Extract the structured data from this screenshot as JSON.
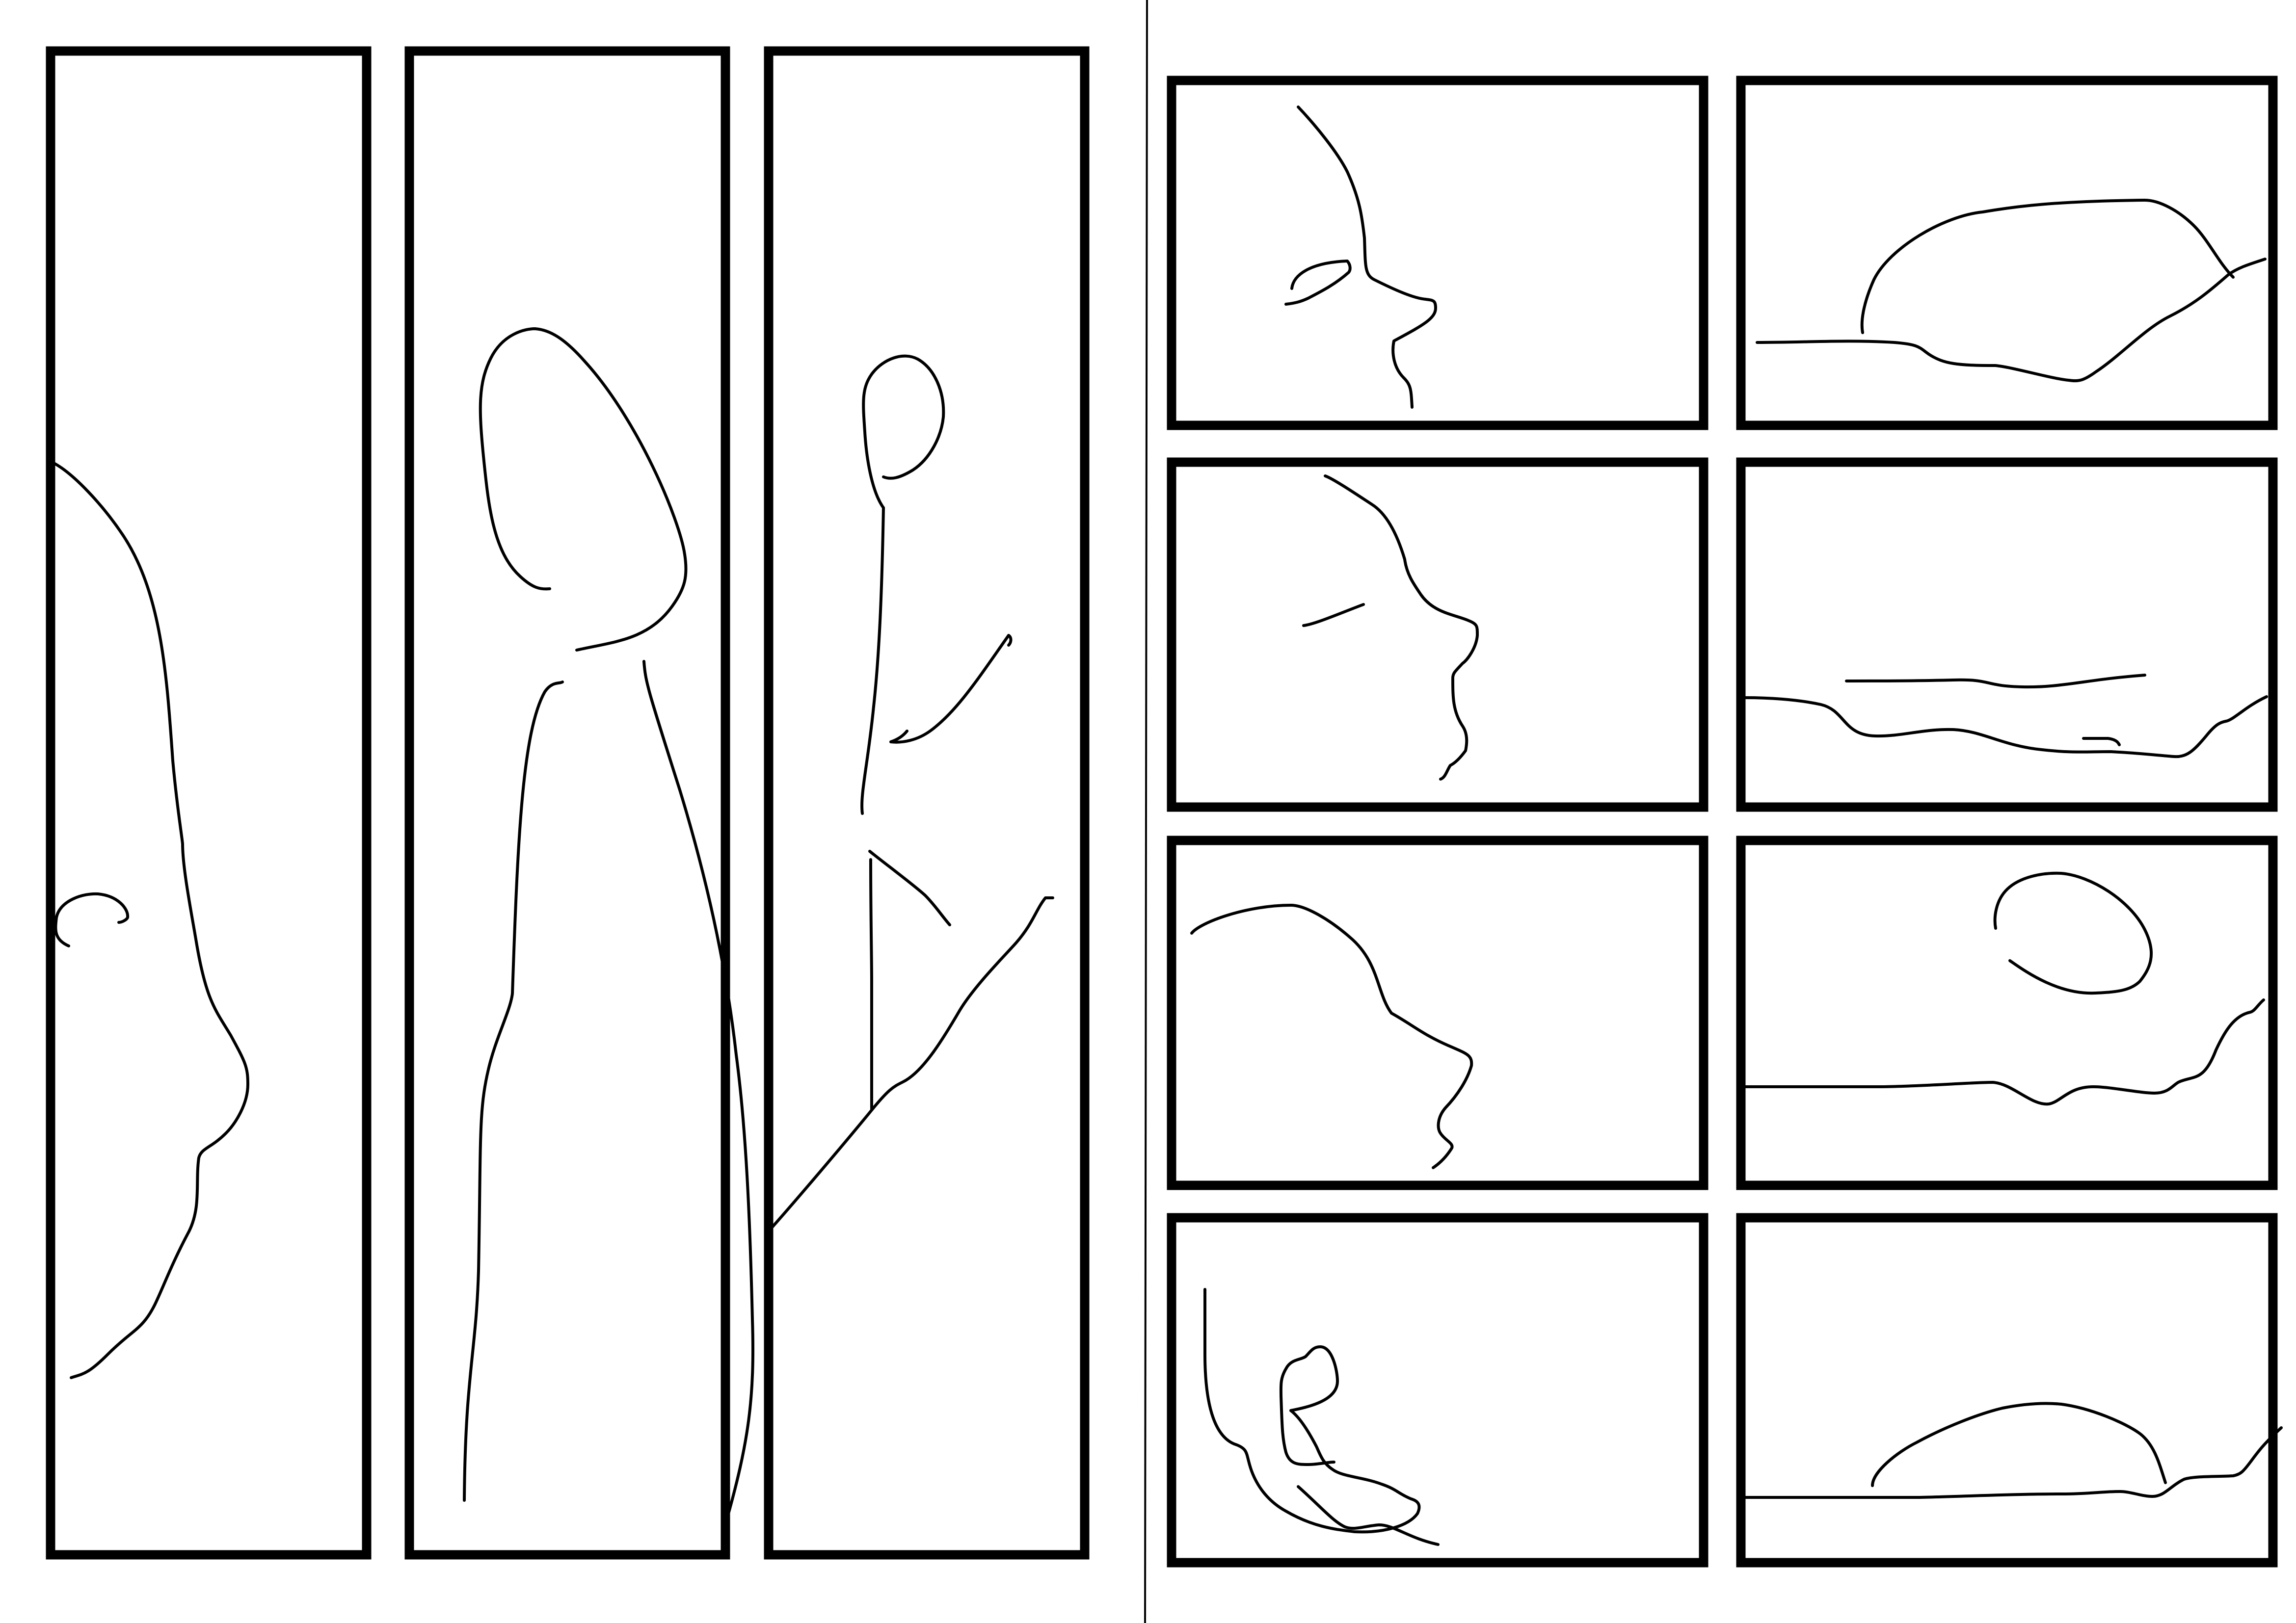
{
  "page": {
    "background": "#ffffff",
    "ink_color": "#000000",
    "layout": "storyboard-spread",
    "left_page_panel_count": 3,
    "right_page_panel_count": 8,
    "text_content": []
  }
}
